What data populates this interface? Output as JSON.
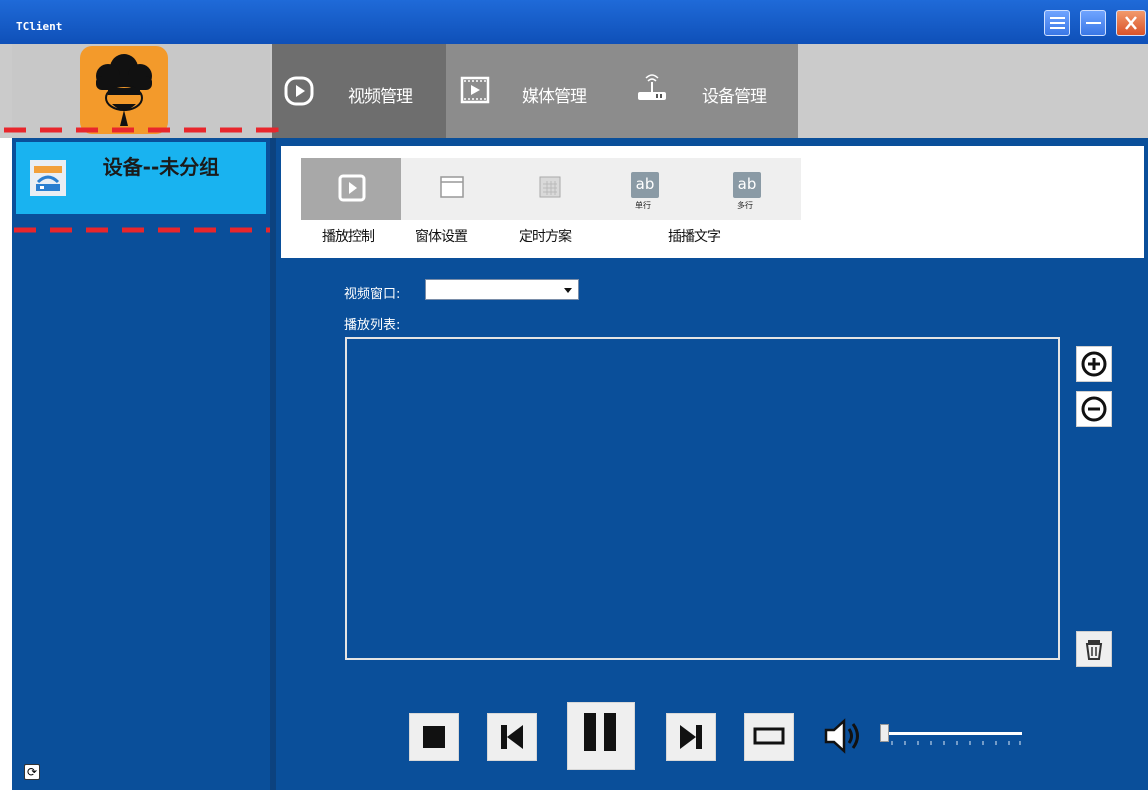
{
  "window": {
    "title": "TClient"
  },
  "nav": {
    "tabs": [
      {
        "label": "视频管理",
        "icon": "play-circle-icon",
        "active": true
      },
      {
        "label": "媒体管理",
        "icon": "film-icon",
        "active": false
      },
      {
        "label": "设备管理",
        "icon": "router-icon",
        "active": false
      }
    ]
  },
  "sidebar": {
    "items": [
      {
        "label": "设备--未分组",
        "icon": "network-device-icon",
        "selected": true
      }
    ]
  },
  "toolbar": {
    "items": [
      {
        "label": "播放控制",
        "icon": "play-square-icon",
        "active": true
      },
      {
        "label": "窗体设置",
        "icon": "window-icon"
      },
      {
        "label": "定时方案",
        "icon": "calendar-icon"
      },
      {
        "label": "插播文字",
        "icon": "text-ab-icon"
      }
    ],
    "text_single": "ab",
    "text_multi": "ab",
    "text_single_caption": "单行",
    "text_multi_caption": "多行"
  },
  "main": {
    "video_window_label": "视频窗口:",
    "video_window_value": "",
    "playlist_label": "播放列表:",
    "playlist_items": []
  },
  "colors": {
    "accent": "#19b3f0",
    "panel": "#0a4f9a",
    "highlight_box": "#e8262c"
  }
}
